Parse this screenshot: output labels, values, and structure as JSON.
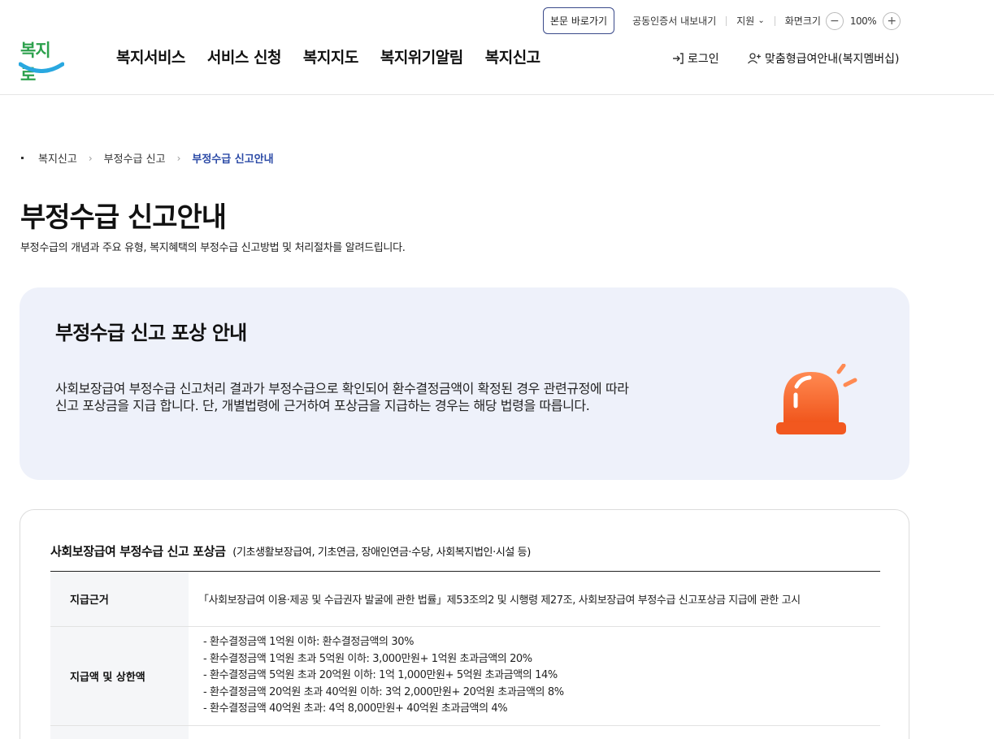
{
  "header": {
    "logo_text": "복지로",
    "utility": {
      "skip_label": "본문 바로가기",
      "cert_label": "공동인증서 내보내기",
      "support_label": "지원",
      "zoom_label": "화면크기",
      "zoom_value": "100%"
    },
    "gnb": [
      "복지서비스",
      "서비스 신청",
      "복지지도",
      "복지위기알림",
      "복지신고"
    ],
    "login_label": "로그인",
    "member_label": "맞춤형급여안내(복지멤버십)"
  },
  "breadcrumb": [
    "복지신고",
    "부정수급 신고",
    "부정수급 신고안내"
  ],
  "page": {
    "title": "부정수급 신고안내",
    "description": "부정수급의 개념과 주요 유형, 복지혜택의 부정수급 신고방법 및 처리절차를 알려드립니다."
  },
  "banner": {
    "title": "부정수급 신고 포상 안내",
    "text_line1": "사회보장급여 부정수급 신고처리 결과가 부정수급으로 확인되어 환수결정금액이  확정된 경우 관련규정에 따라",
    "text_line2": "신고 포상금을 지급 합니다. 단, 개별법령에 근거하여 포상금을 지급하는 경우는 해당 법령을 따릅니다."
  },
  "reward_table": {
    "title": "사회보장급여 부정수급 신고 포상금",
    "subtitle": "(기초생활보장급여, 기초연금, 장애인연금·수당, 사회복지법인·시설 등)",
    "basis_label": "지급근거",
    "basis_value": "「사회보장급여 이용·제공 및 수급권자 발굴에 관한 법률」제53조의2 및 시행령 제27조, 사회보장급여 부정수급 신고포상금 지급에 관한 고시",
    "amount_label": "지급액 및 상한액",
    "amount_lines": [
      "- 환수결정금액 1억원 이하: 환수결정금액의 30%",
      "- 환수결정금액 1억원 초과 5억원 이하: 3,000만원+ 1억원 초과금액의 20%",
      "- 환수결정금액 5억원 초과 20억원 이하: 1억 1,000만원+ 5억원 초과금액의 14%",
      "- 환수결정금액 20억원 초과 40억원 이하: 3억 2,000만원+ 20억원 초과금액의 8%",
      "- 환수결정금액 40억원 초과: 4억 8,000만원+ 40억원 초과금액의 4%"
    ]
  },
  "colors": {
    "logo": "#2da14d",
    "accent": "#2b4aa6",
    "banner_bg": "#eef1fa",
    "siren": "#ff6a2b"
  }
}
